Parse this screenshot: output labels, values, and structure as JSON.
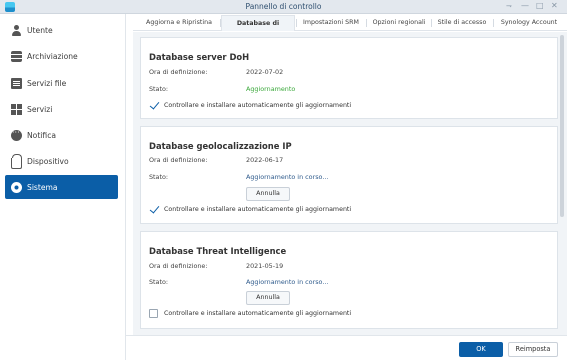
{
  "window": {
    "title": "Pannello di controllo",
    "controls": {
      "pin": "⇁",
      "minimize": "—",
      "maximize": "□",
      "close": "✕"
    }
  },
  "sidebar": {
    "items": [
      {
        "label": "Utente",
        "icon": "user-icon"
      },
      {
        "label": "Archiviazione",
        "icon": "storage-icon"
      },
      {
        "label": "Servizi file",
        "icon": "file-services-icon"
      },
      {
        "label": "Servizi",
        "icon": "services-icon"
      },
      {
        "label": "Notifica",
        "icon": "notification-icon"
      },
      {
        "label": "Dispositivo",
        "icon": "device-icon"
      },
      {
        "label": "Sistema",
        "icon": "system-icon",
        "active": true
      }
    ]
  },
  "tabs": [
    {
      "label": "Aggiorna e Ripristina"
    },
    {
      "label": "Database di sistema",
      "active": true
    },
    {
      "label": "Impostazioni SRM"
    },
    {
      "label": "Opzioni regionali"
    },
    {
      "label": "Stile di accesso"
    },
    {
      "label": "Synology Account"
    }
  ],
  "panels": [
    {
      "title": "Database server DoH",
      "def_label": "Ora di definizione:",
      "def_value": "2022-07-02",
      "status_label": "Stato:",
      "status_value": "Aggiornamento",
      "checkbox_label": "Controllare e installare automaticamente gli aggiornamenti",
      "checked": true
    },
    {
      "title": "Database geolocalizzazione IP",
      "def_label": "Ora di definizione:",
      "def_value": "2022-06-17",
      "status_label": "Stato:",
      "status_value": "Aggiornamento in corso...",
      "cancel_label": "Annulla",
      "checkbox_label": "Controllare e installare automaticamente gli aggiornamenti",
      "checked": true
    },
    {
      "title": "Database Threat Intelligence",
      "def_label": "Ora di definizione:",
      "def_value": "2021-05-19",
      "status_label": "Stato:",
      "status_value": "Aggiornamento in corso...",
      "cancel_label": "Annulla",
      "checkbox_label": "Controllare e installare automaticamente gli aggiornamenti",
      "checked": false
    }
  ],
  "footer": {
    "ok_label": "OK",
    "reset_label": "Reimposta"
  },
  "colors": {
    "accent": "#0b5ea7",
    "status_ok": "#3aa83a",
    "status_progress": "#2f5b8c"
  }
}
